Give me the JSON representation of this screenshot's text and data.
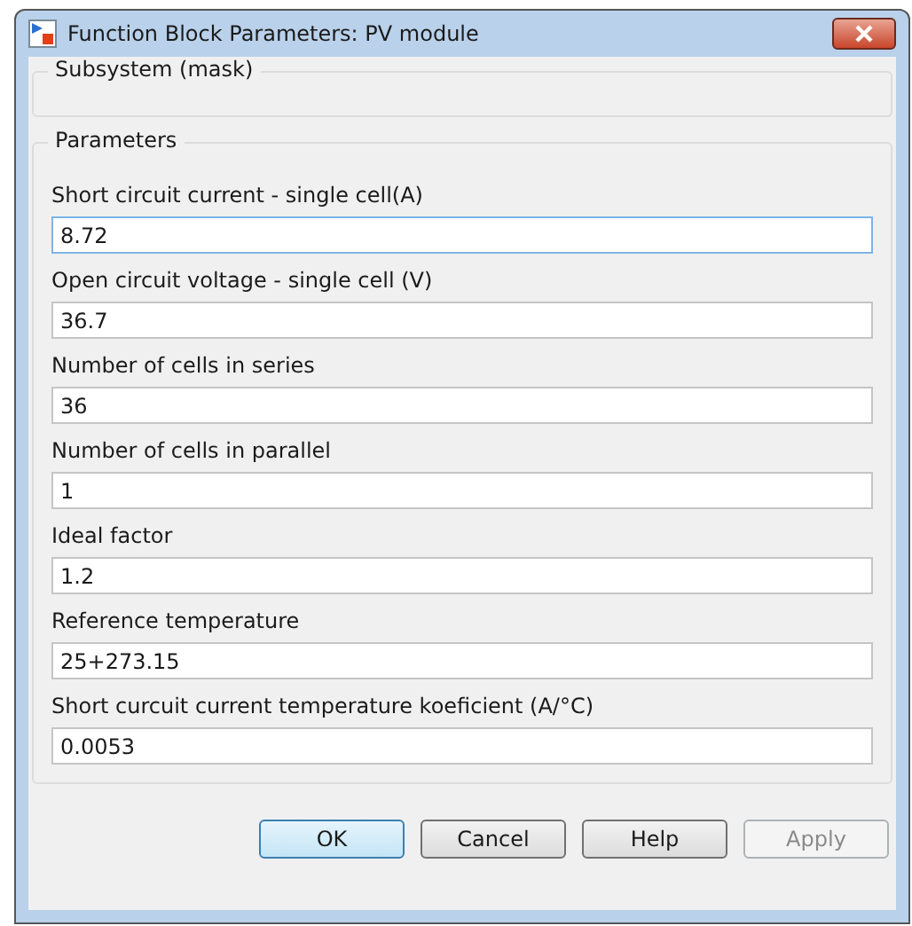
{
  "window": {
    "title": "Function Block Parameters: PV module"
  },
  "mask_group": {
    "title": "Subsystem (mask)"
  },
  "parameters": {
    "title": "Parameters",
    "fields": [
      {
        "label": "Short circuit current - single cell(A)",
        "value": "8.72",
        "focused": true
      },
      {
        "label": "Open circuit voltage - single cell (V)",
        "value": "36.7",
        "focused": false
      },
      {
        "label": "Number of cells in series",
        "value": "36",
        "focused": false
      },
      {
        "label": "Number of cells in parallel",
        "value": "1",
        "focused": false
      },
      {
        "label": "Ideal factor",
        "value": "1.2",
        "focused": false
      },
      {
        "label": "Reference temperature",
        "value": "25+273.15",
        "focused": false
      },
      {
        "label": "Short curcuit current temperature koeficient (A/°C)",
        "value": "0.0053",
        "focused": false
      }
    ]
  },
  "buttons": [
    {
      "label": "OK",
      "default": true,
      "disabled": false
    },
    {
      "label": "Cancel",
      "default": false,
      "disabled": false
    },
    {
      "label": "Help",
      "default": false,
      "disabled": false
    },
    {
      "label": "Apply",
      "default": false,
      "disabled": true
    }
  ]
}
